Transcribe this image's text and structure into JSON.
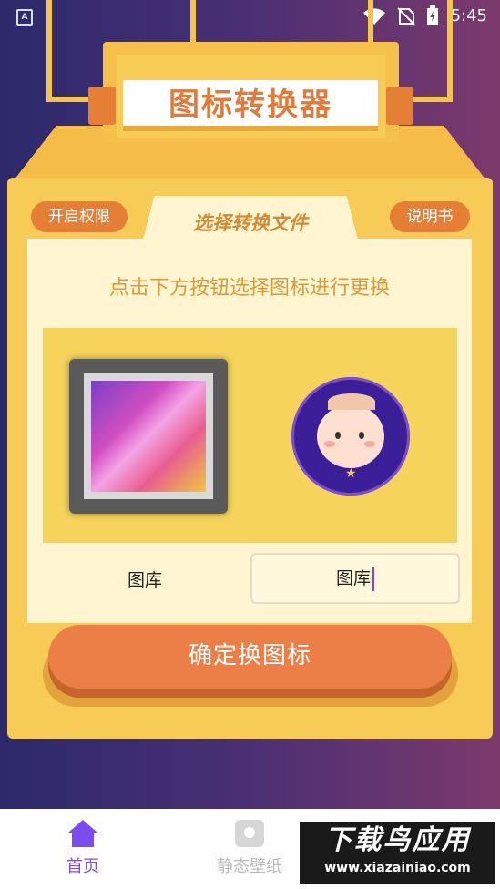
{
  "status_bar": {
    "time": "5:45",
    "left_icon": "A"
  },
  "header": {
    "title": "图标转换器"
  },
  "buttons": {
    "permission": "开启权限",
    "manual": "说明书"
  },
  "tab": {
    "label": "选择转换文件"
  },
  "instruction": "点击下方按钮选择图标进行更换",
  "pickers": {
    "left_label": "图库",
    "right_value": "图库"
  },
  "confirm_button": "确定换图标",
  "nav": {
    "items": [
      {
        "label": "首页",
        "active": true
      },
      {
        "label": "静态壁纸",
        "active": false
      }
    ]
  },
  "watermark": {
    "title": "下载鸟应用",
    "url": "www.xiazainiao.com"
  },
  "colors": {
    "accent": "#e57f36",
    "active_nav": "#7b4cf0",
    "panel": "#fff5d0"
  }
}
